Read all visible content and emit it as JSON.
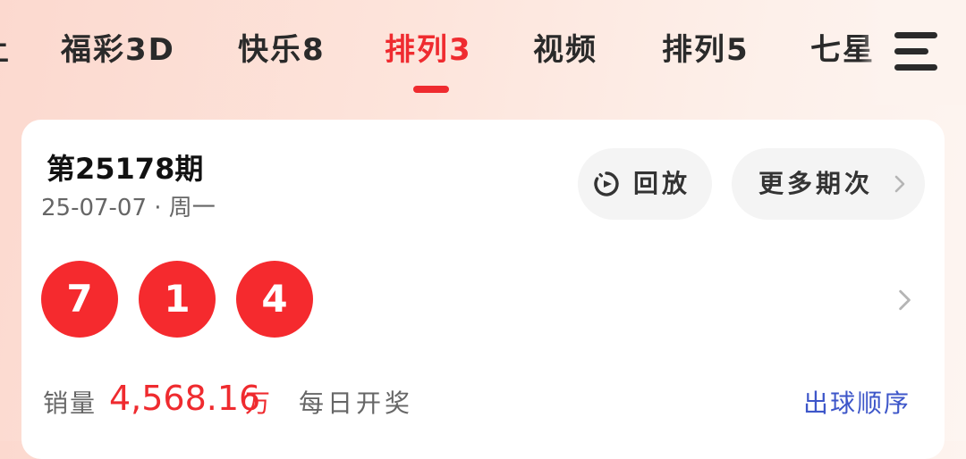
{
  "tabs": [
    {
      "label": "土",
      "active": false
    },
    {
      "label": "福彩3D",
      "active": false
    },
    {
      "label": "快乐8",
      "active": false
    },
    {
      "label": "排列3",
      "active": true
    },
    {
      "label": "视频",
      "active": false
    },
    {
      "label": "排列5",
      "active": false
    },
    {
      "label": "七星",
      "active": false
    }
  ],
  "menu": {
    "icon": "hamburger-menu-icon"
  },
  "draw": {
    "issue_title": "第25178期",
    "date": "25-07-07 · 周一",
    "replay_label": "回放",
    "replay_icon": "replay-timer-icon",
    "more_label": "更多期次",
    "numbers": [
      "7",
      "1",
      "4"
    ]
  },
  "sales": {
    "label": "销量",
    "value": "4,568.16",
    "unit": "万",
    "frequency": "每日开奖",
    "order_label": "出球顺序"
  },
  "colors": {
    "accent": "#ef2b2f",
    "ball": "#f52a2e",
    "link": "#3d56c9"
  }
}
